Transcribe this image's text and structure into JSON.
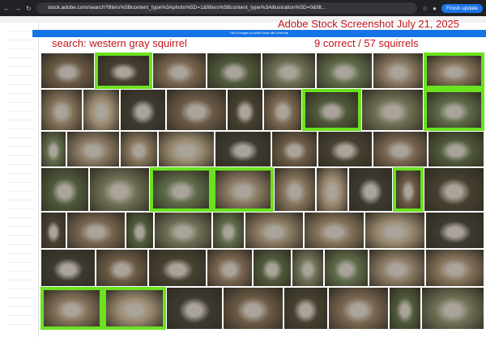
{
  "browser": {
    "url": "stock.adobe.com/search?filters%5Bcontent_type%3Aphoto%5D=1&filters%5Bcontent_type%3Aillustration%5D=0&filt...",
    "finish_update": "Finish update"
  },
  "banner": {
    "text": "Get 10 images on Adobe Stock with a free trial"
  },
  "annotations": {
    "title": "Adobe Stock Screenshot July 21, 2025",
    "search": "search: western gray squirrel",
    "score": "9 correct / 57 squirrels"
  },
  "highlight_color": "#6ae21f",
  "results": {
    "rows": [
      [
        0,
        1,
        0,
        0,
        0,
        0,
        0,
        1
      ],
      [
        0,
        0,
        0,
        0,
        0,
        0,
        1,
        0,
        1
      ],
      [
        0,
        0,
        0,
        0,
        0,
        0,
        0,
        0,
        0
      ],
      [
        0,
        0,
        1,
        1,
        0,
        0,
        0,
        1,
        0
      ],
      [
        0,
        0,
        0,
        0,
        0,
        0,
        0,
        0,
        0
      ],
      [
        0,
        0,
        0,
        0,
        0,
        0,
        0,
        0,
        0
      ],
      [
        1,
        1,
        0,
        0,
        0,
        0,
        0,
        0
      ]
    ]
  }
}
